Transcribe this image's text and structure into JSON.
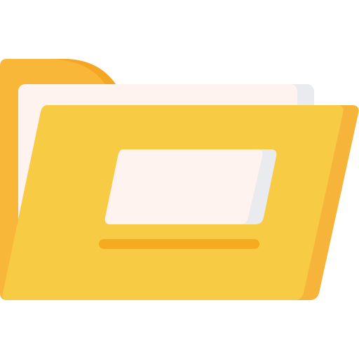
{
  "icon": {
    "name": "open-folder-icon",
    "colors": {
      "folder_back": "#F8B739",
      "folder_tab_shadow": "#F5A623",
      "folder_front": "#F8CB45",
      "folder_front_edge": "#F6B43A",
      "paper": "#FFF3F0",
      "paper_shadow": "#E9EBEF",
      "label_card": "#FFF3F0",
      "label_card_shadow": "#E9EBEF",
      "label_line": "#F6AA1F"
    }
  }
}
